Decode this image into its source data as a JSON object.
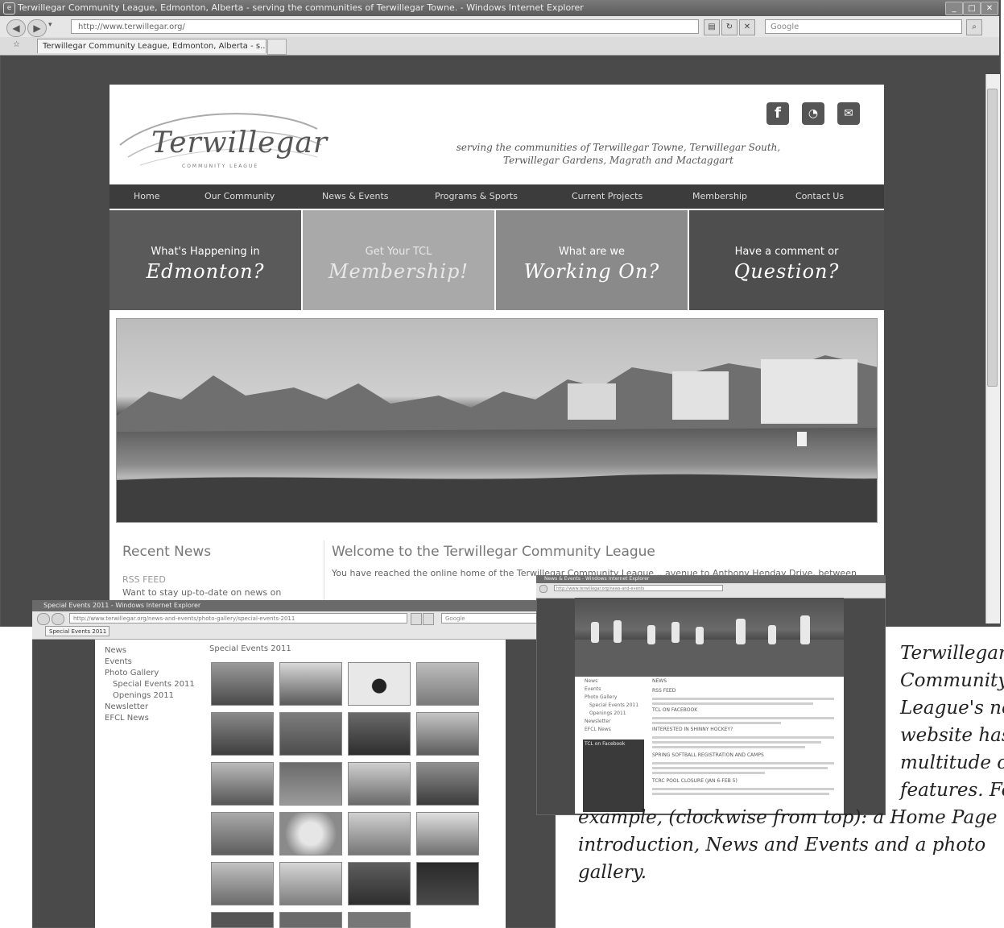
{
  "main_window": {
    "title": "Terwillegar Community League, Edmonton, Alberta - serving the communities of Terwillegar Towne. - Windows Internet Explorer",
    "address": "http://www.terwillegar.org/",
    "search_placeholder": "Google",
    "tab_label": "Terwillegar Community League, Edmonton, Alberta - s..."
  },
  "site": {
    "logo": "Terwillegar",
    "logo_sub": "COMMUNITY LEAGUE",
    "tagline_l1": "serving the communities of Terwillegar Towne, Terwillegar South,",
    "tagline_l2": "Terwillegar Gardens, Magrath and Mactaggart",
    "social": [
      "f",
      "rss",
      "mail"
    ],
    "nav": [
      "Home",
      "Our Community",
      "News & Events",
      "Programs & Sports",
      "Current Projects",
      "Membership",
      "Contact Us"
    ],
    "features": [
      {
        "l1": "What's Happening in",
        "l2": "Edmonton?"
      },
      {
        "l1": "Get Your TCL",
        "l2": "Membership!"
      },
      {
        "l1": "What are we",
        "l2": "Working On?"
      },
      {
        "l1": "Have a comment or",
        "l2": "Question?"
      }
    ],
    "recent_news": "Recent News",
    "rss_feed": "RSS FEED",
    "rss_text": "Want to stay up-to-date on news on",
    "welcome_title": "Welcome to the Terwillegar Community League",
    "welcome_text": "You have reached the online home of the Terwillegar Community League... avenue to Anthony Henday Drive, between"
  },
  "gallery_window": {
    "title": "Special Events 2011 - Windows Internet Explorer",
    "address": "http://www.terwillegar.org/news-and-events/photo-gallery/special-events-2011",
    "search": "Google",
    "tab": "Special Events 2011",
    "sidebar": [
      "News",
      "Events",
      "Photo Gallery",
      "Special Events 2011",
      "Openings 2011",
      "Newsletter",
      "EFCL News"
    ],
    "heading": "Special Events 2011"
  },
  "news_window": {
    "title": "News & Events - Windows Internet Explorer",
    "address": "http://www.terwillegar.org/news-and-events",
    "sidebar": [
      "News",
      "Events",
      "Photo Gallery",
      "Special Events 2011",
      "Openings 2011",
      "Newsletter",
      "EFCL News"
    ],
    "headings": [
      "NEWS",
      "RSS FEED",
      "TCL ON FACEBOOK",
      "INTERESTED IN SHINNY HOCKEY?",
      "SPRING SOFTBALL REGISTRATION AND CAMPS",
      "TCRC POOL CLOSURE (JAN 6-FEB 5)"
    ],
    "facebook_box": "TCL on Facebook"
  },
  "caption": {
    "lines": [
      "Terwillegar",
      "Community",
      "League's new",
      "website has a",
      "multitude of",
      "features. For",
      "example, (clockwise from top): a Home Page",
      "introduction, News and Events and a photo",
      "gallery."
    ]
  }
}
